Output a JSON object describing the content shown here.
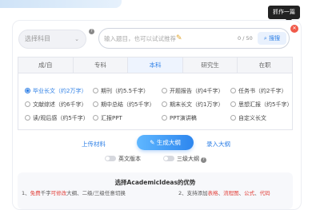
{
  "tooltip": {
    "text": "抓作一篇"
  },
  "subject_select": {
    "placeholder": "选择科目"
  },
  "search": {
    "placeholder": "输入题目，也可以试试推荐",
    "count": "0 / 50",
    "button_label": "搜搜"
  },
  "tabs": [
    "成/自",
    "专科",
    "本科",
    "研究生",
    "在职"
  ],
  "active_tab": "本科",
  "paper_types": [
    {
      "label": "毕业长文（约2万字）",
      "active": true
    },
    {
      "label": "期刊（约5.5千字）",
      "active": false
    },
    {
      "label": "开题报告（约4千字）",
      "active": false
    },
    {
      "label": "任务书（约2千字）",
      "active": false
    },
    {
      "label": "文献综述（约6千字）",
      "active": false
    },
    {
      "label": "期中总结（约5千字）",
      "active": false
    },
    {
      "label": "期末长文（约1万字）",
      "active": false
    },
    {
      "label": "思想汇报（约5千字）",
      "active": false
    },
    {
      "label": "读/观后感（约5千字）",
      "active": false
    },
    {
      "label": "汇报PPT",
      "active": false
    },
    {
      "label": "PPT演讲稿",
      "active": false
    },
    {
      "label": "自定义长文",
      "active": false
    }
  ],
  "actions": {
    "upload": "上传材料",
    "generate": "生成大纲",
    "import": "录入大纲"
  },
  "toggles": {
    "english": "英文版本",
    "three_level": "三级大纲"
  },
  "advantages": {
    "title": "选择AcademicIdeas的优势",
    "item1": {
      "prefix": "1、",
      "hl1": "免费",
      "mid1": "千字",
      "hl2": "可修改",
      "rest": "大纲、二级/三级任意切换"
    },
    "item2": {
      "prefix": "2、支持添加",
      "hl1": "表格",
      "sep1": "、",
      "hl2": "流程图",
      "sep2": "、",
      "hl3": "公式",
      "sep3": "、",
      "hl4": "代码"
    }
  },
  "colors": {
    "accent": "#2d7fe6",
    "highlight": "#e2423b",
    "close": "#f05a4a"
  }
}
